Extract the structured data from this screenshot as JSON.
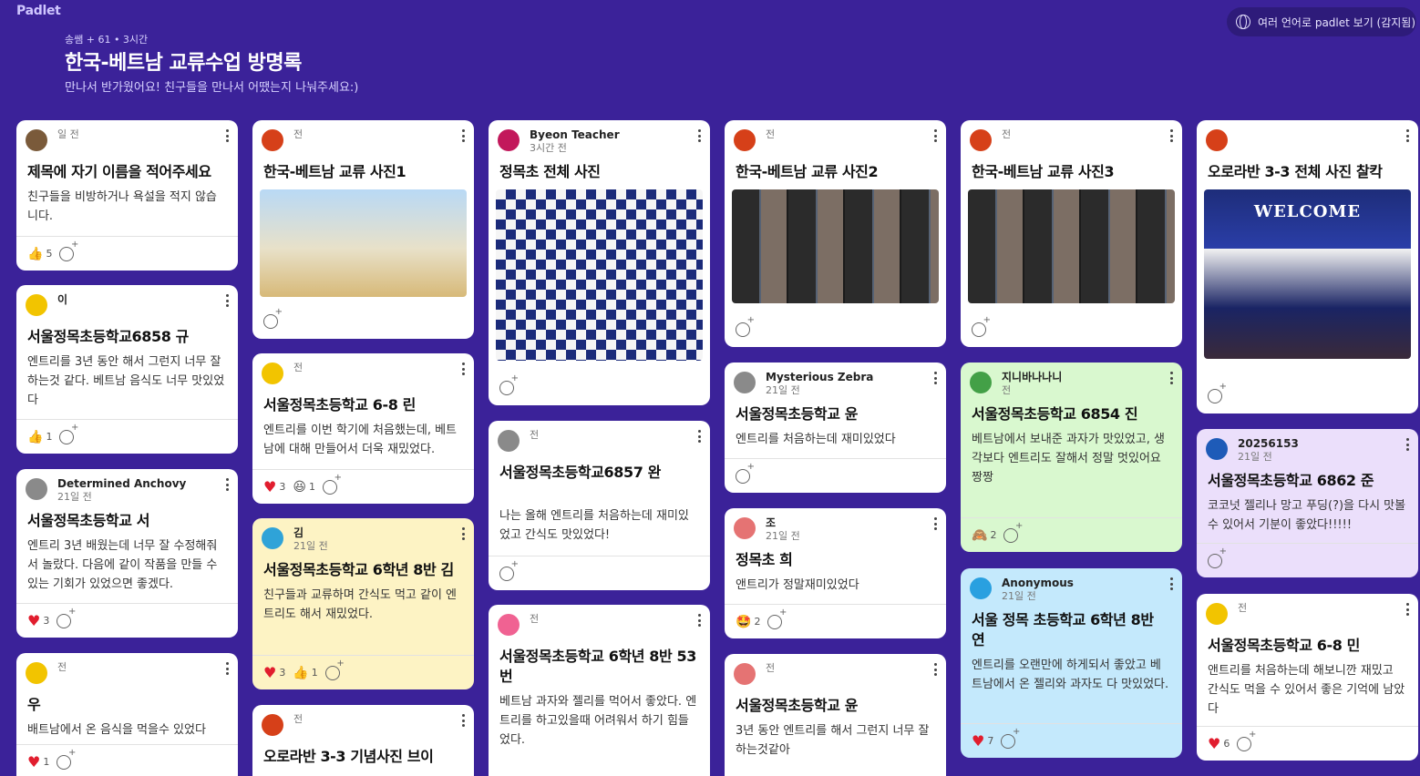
{
  "app": {
    "logo": "Padlet"
  },
  "lang_button": {
    "label": "여러 언어로 padlet 보기 (감지됨)"
  },
  "header": {
    "meta": "송쌤 + 61 • 3시간",
    "title": "한국-베트남 교류수업 방명록",
    "description": "만나서 반가웠어요! 친구들을 만나서 어땠는지 나눠주세요:)"
  },
  "colors": {
    "background": "#3b2299",
    "heart": "#e11d2e"
  },
  "cards": [
    {
      "author": "",
      "time": "일 전",
      "title": "제목에 자기 이름을 적어주세요",
      "body": "친구들을 비방하거나 욕설을 적지 않습니다.",
      "reactions": [
        {
          "icon": "thumbs-up",
          "count": "5"
        }
      ]
    },
    {
      "author": "이",
      "time": "",
      "title": "서울정목초등학교6858 규",
      "body": "엔트리를 3년 동안 해서 그런지 너무 잘하는것 같다. 베트남 음식도 너무 맛있었다",
      "reactions": [
        {
          "icon": "thumbs-up",
          "count": "1"
        }
      ]
    },
    {
      "author": "Determined Anchovy",
      "time": "21일 전",
      "title": "서울정목초등학교 서",
      "body": "엔트리 3년 배웠는데 너무 잘 수정해줘서 놀랐다. 다음에 같이 작품을 만들 수 있는 기회가 있었으면 좋겠다.",
      "reactions": [
        {
          "icon": "heart",
          "count": "3"
        }
      ]
    },
    {
      "author": "",
      "time": "전",
      "title": "우",
      "body": "배트남에서 온 음식을 먹을수 있었다",
      "reactions": [
        {
          "icon": "heart",
          "count": "1"
        }
      ]
    },
    {
      "author": "",
      "time": "전",
      "title": "한국-베트남 교류 사진1",
      "reactions": []
    },
    {
      "author": "",
      "time": "전",
      "title": "서울정목초등학교 6-8 린",
      "body": "엔트리를 이번 학기에 처음했는데, 베트남에 대해 만들어서 더욱 재밌었다.",
      "reactions": [
        {
          "icon": "heart",
          "count": "3"
        },
        {
          "icon": "laugh",
          "count": "1"
        }
      ]
    },
    {
      "author": "김",
      "time": "21일 전",
      "title": "서울정목초등학교 6학년 8반 김",
      "body": "친구들과 교류하며 간식도 먹고 같이 엔트리도 해서 재밌었다.",
      "reactions": [
        {
          "icon": "heart",
          "count": "3"
        },
        {
          "icon": "thumbs-up",
          "count": "1"
        }
      ]
    },
    {
      "author": "",
      "time": "전",
      "title": "오로라반 3-3 기념사진 브이",
      "reactions": []
    },
    {
      "author": "Byeon Teacher",
      "time": "3시간 전",
      "title": "정목초 전체 사진",
      "reactions": []
    },
    {
      "author": "",
      "time": "전",
      "title": "서울정목초등학교6857 완",
      "body": "나는 올해 엔트리를 처음하는데 재미있었고 간식도 맛있었다!",
      "reactions": []
    },
    {
      "author": "",
      "time": "전",
      "title": "서울정목초등학교 6학년 8반 53번",
      "body": "베트남 과자와 젤리를 먹어서 좋았다. 엔트리를 하고있을때 어려워서 하기 힘들었다.",
      "reactions": []
    },
    {
      "author": "",
      "time": "전",
      "title": "한국-베트남 교류 사진2",
      "reactions": []
    },
    {
      "author": "Mysterious Zebra",
      "time": "21일 전",
      "title": "서울정목초등학교 윤",
      "body": "엔트리를 처음하는데 재미있었다",
      "reactions": []
    },
    {
      "author": "조",
      "time": "21일 전",
      "title": "정목초 희",
      "body": "앤트리가 정말재미있었다",
      "reactions": [
        {
          "icon": "star-eyes",
          "count": "2"
        }
      ]
    },
    {
      "author": "",
      "time": "전",
      "title": "서울정목초등학교 윤",
      "body": "3년 동안 엔트리를 해서 그런지 너무 잘하는것같아",
      "reactions": []
    },
    {
      "author": "",
      "time": "전",
      "title": "한국-베트남 교류 사진3",
      "reactions": []
    },
    {
      "author": "지니바나나니",
      "time": "전",
      "title": "서울정목초등학교 6854 진",
      "body": "베트남에서 보내준 과자가 맛있었고, 생각보다 엔트리도 잘해서 정말 멋있어요 짱짱",
      "reactions": [
        {
          "icon": "monkey",
          "count": "2"
        }
      ]
    },
    {
      "author": "Anonymous",
      "time": "21일 전",
      "title": "서울 정목 초등학교 6학년 8반 연",
      "body": "엔트리를 오랜만에 하게되서 좋았고 베트남에서 온 젤리와 과자도 다 맛있었다.",
      "reactions": [
        {
          "icon": "heart",
          "count": "7"
        }
      ]
    },
    {
      "author": "",
      "time": "",
      "title": "오로라반 3-3 전체 사진 찰칵",
      "image_label": "WELCOME",
      "reactions": []
    },
    {
      "author": "20256153",
      "time": "21일 전",
      "title": "서울정목초등학교 6862 준",
      "body": "코코넛 젤리나 망고 푸딩(?)을 다시 맛볼 수 있어서 기분이 좋았다!!!!!",
      "reactions": []
    },
    {
      "author": "",
      "time": "전",
      "title": "서울정목초등학교 6-8 민",
      "body": "앤트리를 처음하는데 해보니깐 재밌고 간식도 먹을 수 있어서 좋은 기억에 남았다",
      "reactions": [
        {
          "icon": "heart",
          "count": "6"
        }
      ]
    }
  ]
}
